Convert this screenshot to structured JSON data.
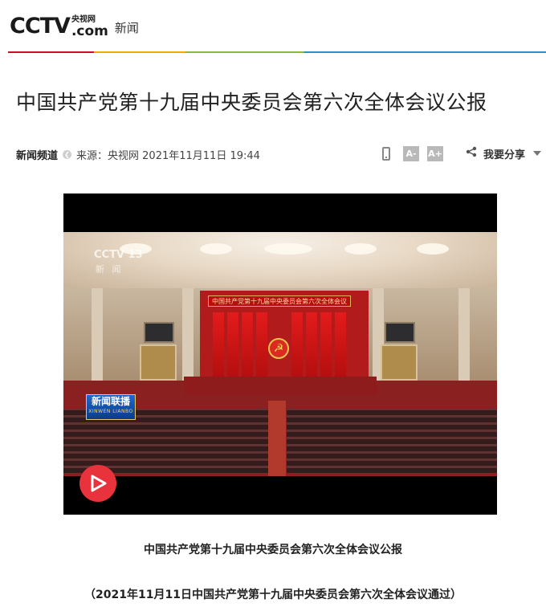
{
  "header": {
    "logo_cctv": "CCTV",
    "logo_cn": "央视网",
    "logo_com": ".com",
    "logo_news": "新闻"
  },
  "article": {
    "title": "中国共产党第十九届中央委员会第六次全体会议公报",
    "channel": "新闻频道",
    "source": "来源：央视网 2021年11月11日 19:44"
  },
  "tools": {
    "font_smaller": "A-",
    "font_larger": "A+",
    "share_label": "我要分享"
  },
  "video": {
    "banner_text": "中国共产党第十九届中央委员会第六次全体会议",
    "watermark_channel": "CCTV 13",
    "watermark_news": "新 闻",
    "program_logo_zh": "新闻联播",
    "program_logo_py": "XINWEN LIANBO",
    "emblem": "☭"
  },
  "captions": {
    "line1": "中国共产党第十九届中央委员会第六次全体会议公报",
    "line2": "（2021年11月11日中国共产党第十九届中央委员会第六次全体会议通过）"
  },
  "colors": {
    "accent_red": "#c8102e",
    "play_red": "#e8323c"
  }
}
